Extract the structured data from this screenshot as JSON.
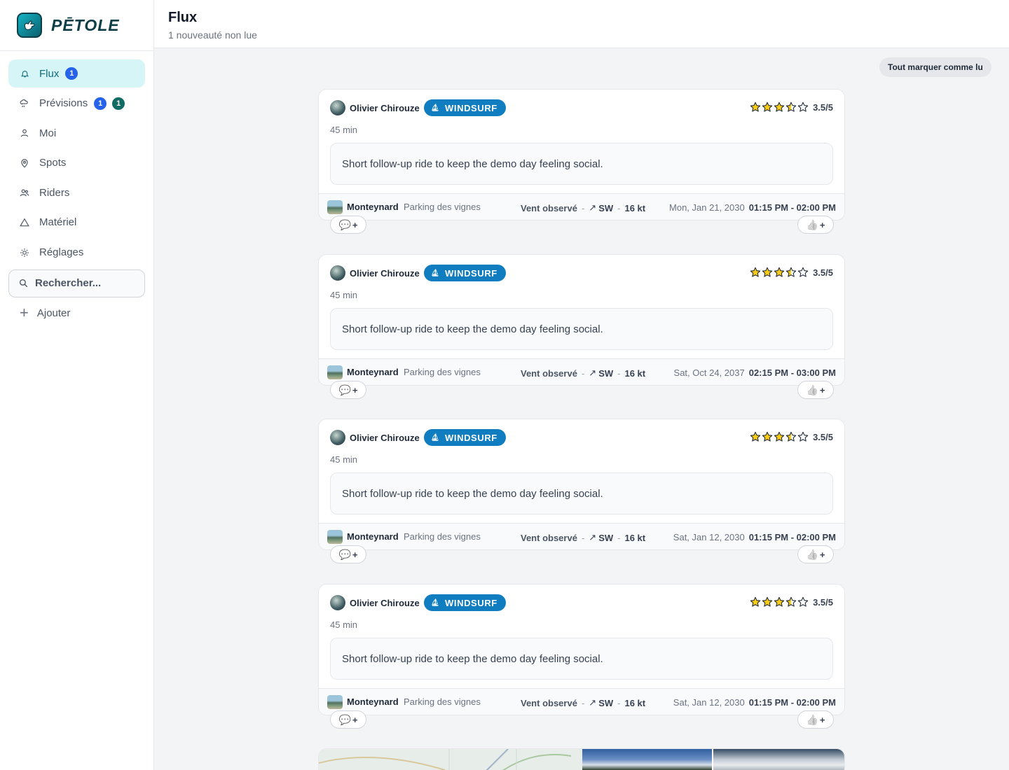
{
  "app": {
    "name": "PĒTOLE"
  },
  "sidebar": {
    "items": [
      {
        "label": "Flux",
        "badges": [
          "1"
        ],
        "icon": "bell-icon",
        "active": true
      },
      {
        "label": "Prévisions",
        "badges": [
          "1",
          "1"
        ],
        "icon": "cloud-wind-icon",
        "active": false
      },
      {
        "label": "Moi",
        "badges": [],
        "icon": "user-icon",
        "active": false
      },
      {
        "label": "Spots",
        "badges": [],
        "icon": "map-pin-icon",
        "active": false
      },
      {
        "label": "Riders",
        "badges": [],
        "icon": "users-icon",
        "active": false
      },
      {
        "label": "Matériel",
        "badges": [],
        "icon": "triangle-icon",
        "active": false
      },
      {
        "label": "Réglages",
        "badges": [],
        "icon": "sun-gear-icon",
        "active": false
      }
    ],
    "search_placeholder": "Rechercher...",
    "add_label": "Ajouter"
  },
  "header": {
    "title": "Flux",
    "subtitle": "1 nouveauté non lue",
    "mark_all_label": "Tout marquer comme lu"
  },
  "feed": [
    {
      "author": "Olivier Chirouze",
      "sport": "WINDSURF",
      "rating": 3.5,
      "rating_label": "3.5/5",
      "duration": "45 min",
      "description": "Short follow-up ride to keep the demo day feeling social.",
      "spot": "Monteynard",
      "parking": "Parking des vignes",
      "wind_label": "Vent observé",
      "wind_dir": "SW",
      "wind_speed": "16 kt",
      "date": "Mon, Jan 21, 2030",
      "time": "01:15 PM - 02:00 PM"
    },
    {
      "author": "Olivier Chirouze",
      "sport": "WINDSURF",
      "rating": 3.5,
      "rating_label": "3.5/5",
      "duration": "45 min",
      "description": "Short follow-up ride to keep the demo day feeling social.",
      "spot": "Monteynard",
      "parking": "Parking des vignes",
      "wind_label": "Vent observé",
      "wind_dir": "SW",
      "wind_speed": "16 kt",
      "date": "Sat, Oct 24, 2037",
      "time": "02:15 PM - 03:00 PM"
    },
    {
      "author": "Olivier Chirouze",
      "sport": "WINDSURF",
      "rating": 3.5,
      "rating_label": "3.5/5",
      "duration": "45 min",
      "description": "Short follow-up ride to keep the demo day feeling social.",
      "spot": "Monteynard",
      "parking": "Parking des vignes",
      "wind_label": "Vent observé",
      "wind_dir": "SW",
      "wind_speed": "16 kt",
      "date": "Sat, Jan 12, 2030",
      "time": "01:15 PM - 02:00 PM"
    },
    {
      "author": "Olivier Chirouze",
      "sport": "WINDSURF",
      "rating": 3.5,
      "rating_label": "3.5/5",
      "duration": "45 min",
      "description": "Short follow-up ride to keep the demo day feeling social.",
      "spot": "Monteynard",
      "parking": "Parking des vignes",
      "wind_label": "Vent observé",
      "wind_dir": "SW",
      "wind_speed": "16 kt",
      "date": "Sat, Jan 12, 2030",
      "time": "01:15 PM - 02:00 PM"
    }
  ],
  "colors": {
    "accent": "#0e6d7a",
    "active_bg": "#d5f5f6",
    "sport_badge": "#0f7dc0",
    "badge_blue": "#2563eb",
    "badge_teal": "#0f6b64",
    "star": "#facc15"
  }
}
